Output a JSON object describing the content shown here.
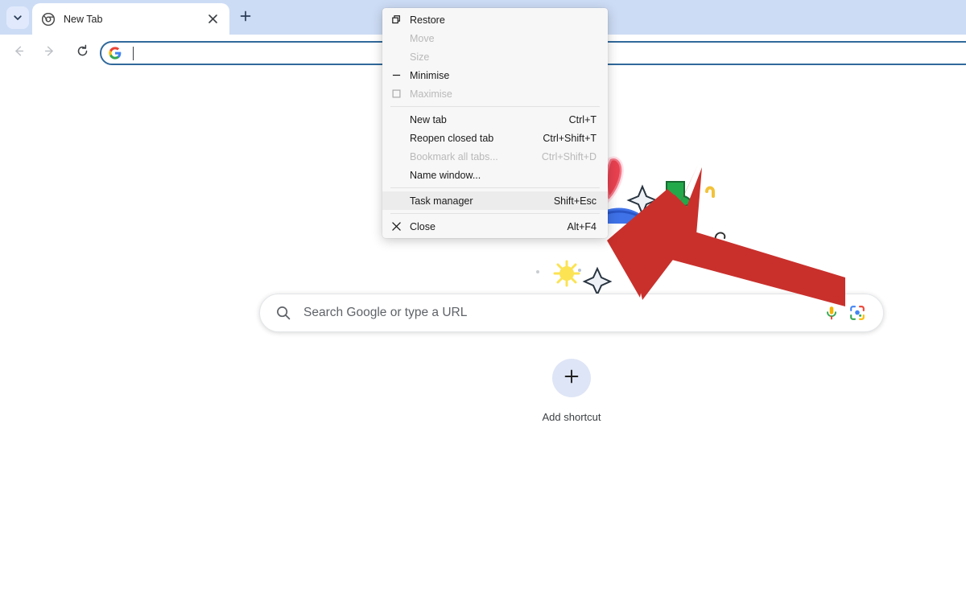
{
  "browser": {
    "tab_search_icon": "chevron-down-icon",
    "tab": {
      "favicon": "chrome-logo-icon",
      "title": "New Tab",
      "close_icon": "close-icon"
    },
    "new_tab_icon": "plus-icon",
    "toolbar": {
      "back_icon": "arrow-left-icon",
      "forward_icon": "arrow-right-icon",
      "reload_icon": "reload-icon"
    },
    "omnibox": {
      "value": "",
      "placeholder": "",
      "leading_icon": "google-g-icon"
    }
  },
  "newtab": {
    "search": {
      "placeholder": "Search Google or type a URL",
      "search_icon": "magnifier-icon",
      "mic_icon": "microphone-icon",
      "lens_icon": "google-lens-icon"
    },
    "shortcut": {
      "icon": "plus-icon",
      "label": "Add shortcut"
    },
    "doodle": {
      "name": "google-doodle-scribble-art"
    }
  },
  "system_menu": {
    "items": [
      {
        "label": "Restore",
        "accel": "",
        "icon": "restore-window-icon",
        "disabled": false,
        "hover": false
      },
      {
        "label": "Move",
        "accel": "",
        "icon": "",
        "disabled": true,
        "hover": false
      },
      {
        "label": "Size",
        "accel": "",
        "icon": "",
        "disabled": true,
        "hover": false
      },
      {
        "label": "Minimise",
        "accel": "",
        "icon": "minimise-window-icon",
        "disabled": false,
        "hover": false
      },
      {
        "label": "Maximise",
        "accel": "",
        "icon": "maximise-window-icon",
        "disabled": true,
        "hover": false
      },
      {
        "label": "New tab",
        "accel": "Ctrl+T",
        "icon": "",
        "disabled": false,
        "hover": false
      },
      {
        "label": "Reopen closed tab",
        "accel": "Ctrl+Shift+T",
        "icon": "",
        "disabled": false,
        "hover": false
      },
      {
        "label": "Bookmark all tabs...",
        "accel": "Ctrl+Shift+D",
        "icon": "",
        "disabled": true,
        "hover": false
      },
      {
        "label": "Name window...",
        "accel": "",
        "icon": "",
        "disabled": false,
        "hover": false
      },
      {
        "label": "Task manager",
        "accel": "Shift+Esc",
        "icon": "",
        "disabled": false,
        "hover": true
      },
      {
        "label": "Close",
        "accel": "Alt+F4",
        "icon": "close-x-icon",
        "disabled": false,
        "hover": false
      }
    ],
    "separator_after": [
      4,
      8,
      9
    ]
  },
  "annotation": {
    "arrow_color": "#c9302c",
    "name": "red-pointer-arrow"
  },
  "colors": {
    "tabstrip_bg": "#cddcf5",
    "omnibox_border": "#31699b",
    "shortcut_circle": "#dee5f6",
    "menu_bg": "#f7f7f7",
    "menu_hover": "#ececec"
  }
}
